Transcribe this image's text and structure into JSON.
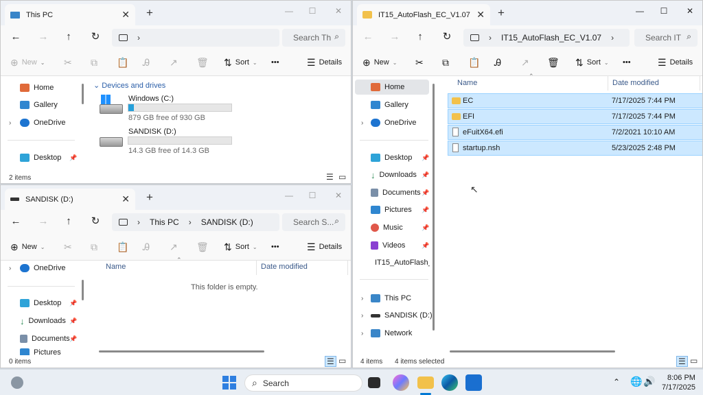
{
  "icons": {
    "back": "←",
    "forward": "→",
    "up": "↑",
    "refresh": "↻",
    "chevron": "›",
    "close": "✕",
    "plus": "+",
    "minimize": "—",
    "maximize": "☐",
    "search": "⌕",
    "caret": "⌄",
    "sort": "⇅",
    "more": "•••",
    "pin": "📌",
    "cut": "✂",
    "new": "⊕",
    "details": "☰"
  },
  "colors": {
    "accent": "#0078d4",
    "selection": "#cce8ff",
    "drive_fill": "#26a0da"
  },
  "this_pc": {
    "tab_title": "This PC",
    "search_placeholder": "Search Th",
    "toolbar": {
      "new": "New",
      "sort": "Sort",
      "details": "Details"
    },
    "nav": [
      {
        "label": "Home"
      },
      {
        "label": "Gallery"
      },
      {
        "label": "OneDrive"
      },
      {
        "label": "Desktop"
      }
    ],
    "group_header": "Devices and drives",
    "drives": [
      {
        "name": "Windows (C:)",
        "free": "879 GB free of 930 GB",
        "used_fraction": 0.055
      },
      {
        "name": "SANDISK (D:)",
        "free": "14.3 GB free of 14.3 GB",
        "used_fraction": 0.0
      }
    ],
    "status": "2 items"
  },
  "sandisk": {
    "tab_title": "SANDISK (D:)",
    "breadcrumb": [
      "This PC",
      "SANDISK (D:)"
    ],
    "search_placeholder": "Search S...",
    "toolbar": {
      "new": "New",
      "sort": "Sort",
      "details": "Details"
    },
    "nav": [
      {
        "label": "OneDrive"
      },
      {
        "label": "Desktop"
      },
      {
        "label": "Downloads"
      },
      {
        "label": "Documents"
      },
      {
        "label": "Pictures"
      }
    ],
    "columns": {
      "name": "Name",
      "date": "Date modified"
    },
    "empty_message": "This folder is empty.",
    "status": "0 items"
  },
  "autoflash": {
    "tab_title": "IT15_AutoFlash_EC_V1.07",
    "breadcrumb": [
      "IT15_AutoFlash_EC_V1.07"
    ],
    "search_placeholder": "Search IT",
    "toolbar": {
      "new": "New",
      "sort": "Sort",
      "details": "Details"
    },
    "nav": [
      {
        "label": "Home"
      },
      {
        "label": "Gallery"
      },
      {
        "label": "OneDrive"
      },
      {
        "label": "Desktop"
      },
      {
        "label": "Downloads"
      },
      {
        "label": "Documents"
      },
      {
        "label": "Pictures"
      },
      {
        "label": "Music"
      },
      {
        "label": "Videos"
      },
      {
        "label": "IT15_AutoFlash_"
      },
      {
        "label": "This PC"
      },
      {
        "label": "SANDISK (D:)"
      },
      {
        "label": "Network"
      }
    ],
    "columns": {
      "name": "Name",
      "date": "Date modified"
    },
    "files": [
      {
        "name": "EC",
        "date": "7/17/2025 7:44 PM",
        "type": "folder"
      },
      {
        "name": "EFI",
        "date": "7/17/2025 7:44 PM",
        "type": "folder"
      },
      {
        "name": "eFuitX64.efi",
        "date": "7/2/2021 10:10 AM",
        "type": "file"
      },
      {
        "name": "startup.nsh",
        "date": "5/23/2025 2:48 PM",
        "type": "file"
      }
    ],
    "status_items": "4 items",
    "status_selected": "4 items selected"
  },
  "taskbar": {
    "search_label": "Search",
    "time": "8:06 PM",
    "date": "7/17/2025"
  }
}
